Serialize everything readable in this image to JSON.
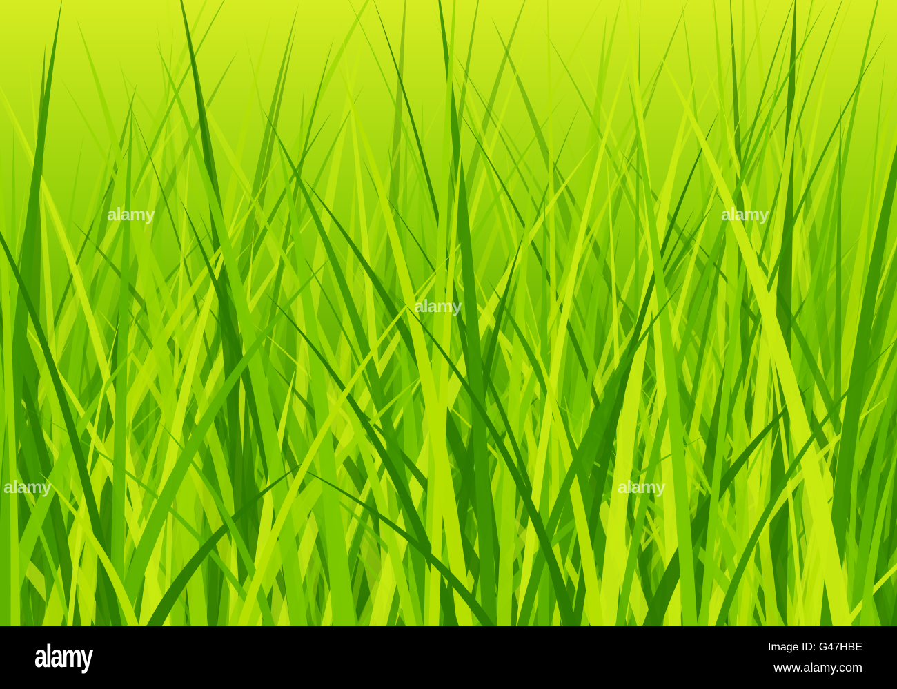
{
  "image": {
    "subject": "grass",
    "colors": {
      "sky_light": "#d9ee1c",
      "bright_green": "#8fd400",
      "mid_green": "#4aa600",
      "dark_green": "#1f6a00"
    }
  },
  "footer": {
    "logo": "alamy",
    "image_id": "Image ID: G47HBE",
    "url": "www.alamy.com"
  },
  "watermark": "alamy"
}
